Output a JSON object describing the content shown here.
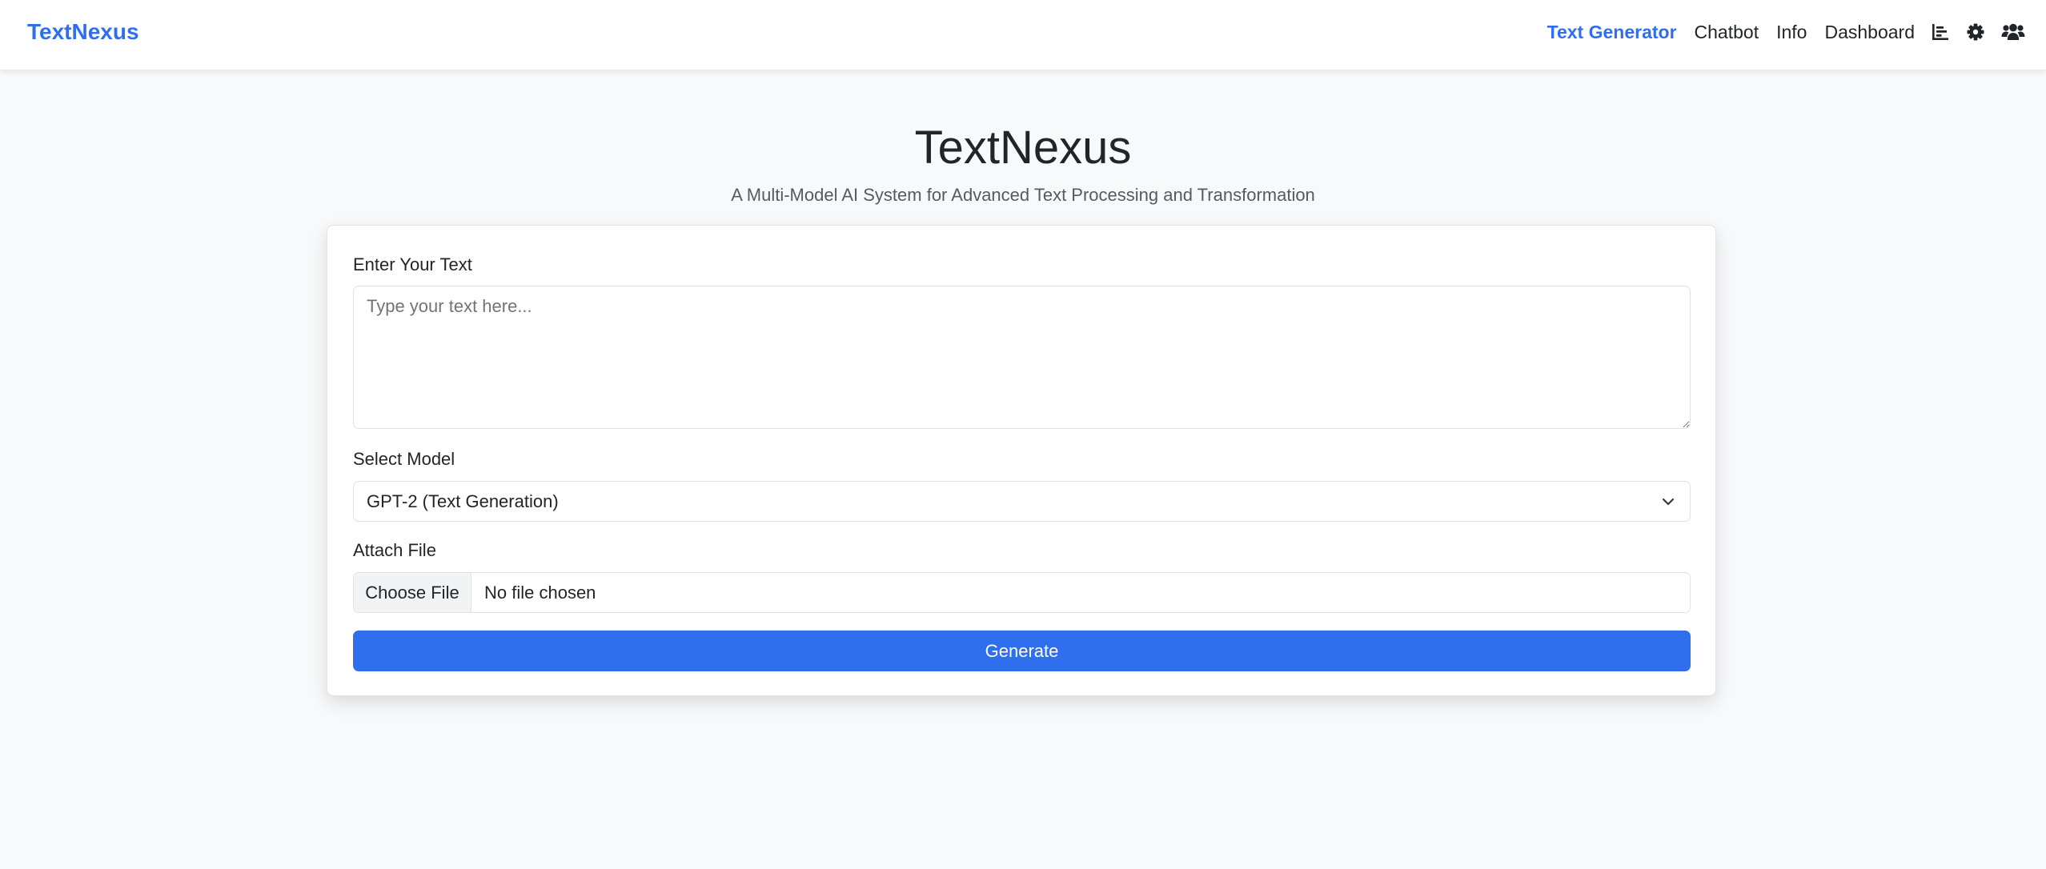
{
  "nav": {
    "brand": "TextNexus",
    "links": [
      "Text Generator",
      "Chatbot",
      "Info",
      "Dashboard"
    ],
    "active_link": "Text Generator",
    "icons": [
      "chart-bar-icon",
      "gear-icon",
      "users-icon"
    ],
    "accent_color": "#2f6fed"
  },
  "hero": {
    "title": "TextNexus",
    "subtitle": "A Multi-Model AI System for Advanced Text Processing and Transformation"
  },
  "form": {
    "text_label": "Enter Your Text",
    "text_placeholder": "Type your text here...",
    "text_value": "",
    "model_label": "Select Model",
    "model_selected": "GPT-2 (Text Generation)",
    "file_label": "Attach File",
    "file_button": "Choose File",
    "file_status": "No file chosen",
    "generate_label": "Generate"
  }
}
